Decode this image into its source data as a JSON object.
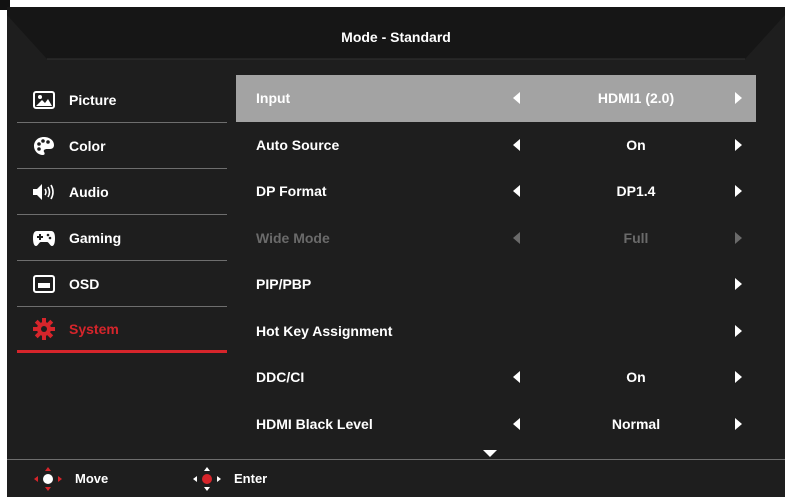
{
  "header": {
    "title": "Mode - Standard"
  },
  "sidebar": {
    "items": [
      {
        "label": "Picture",
        "icon": "picture-icon",
        "active": false
      },
      {
        "label": "Color",
        "icon": "palette-icon",
        "active": false
      },
      {
        "label": "Audio",
        "icon": "speaker-icon",
        "active": false
      },
      {
        "label": "Gaming",
        "icon": "gamepad-icon",
        "active": false
      },
      {
        "label": "OSD",
        "icon": "osd-window-icon",
        "active": false
      },
      {
        "label": "System",
        "icon": "gear-icon",
        "active": true
      }
    ]
  },
  "settings": {
    "rows": [
      {
        "label": "Input",
        "value": "HDMI1 (2.0)",
        "selected": true
      },
      {
        "label": "Auto Source",
        "value": "On"
      },
      {
        "label": "DP Format",
        "value": "DP1.4"
      },
      {
        "label": "Wide Mode",
        "value": "Full",
        "disabled": true
      },
      {
        "label": "PIP/PBP",
        "value": ""
      },
      {
        "label": "Hot Key Assignment",
        "value": ""
      },
      {
        "label": "DDC/CI",
        "value": "On"
      },
      {
        "label": "HDMI Black Level",
        "value": "Normal"
      }
    ]
  },
  "footer": {
    "move_label": "Move",
    "enter_label": "Enter"
  },
  "colors": {
    "accent": "#d6252b",
    "selected_row": "#a3a3a3",
    "background": "#1e1e1e"
  }
}
